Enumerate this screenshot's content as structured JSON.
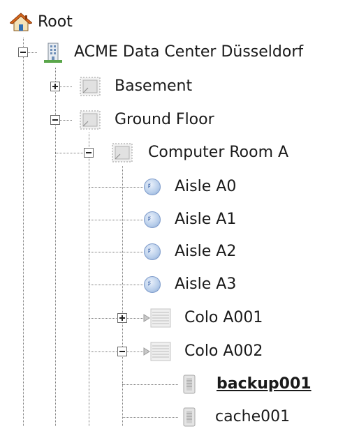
{
  "tree": {
    "root": {
      "label": "Root",
      "icon": "house-icon"
    },
    "site": {
      "label": "ACME Data Center Düsseldorf",
      "icon": "building-icon",
      "state": "expanded"
    },
    "basement": {
      "label": "Basement",
      "icon": "floor-plan-icon",
      "state": "collapsed"
    },
    "ground_floor": {
      "label": "Ground Floor",
      "icon": "floor-plan-icon",
      "state": "expanded"
    },
    "room": {
      "label": "Computer Room A",
      "icon": "floor-plan-icon",
      "state": "expanded"
    },
    "aisles": [
      {
        "label": "Aisle A0",
        "icon": "aisle-icon"
      },
      {
        "label": "Aisle A1",
        "icon": "aisle-icon"
      },
      {
        "label": "Aisle A2",
        "icon": "aisle-icon"
      },
      {
        "label": "Aisle A3",
        "icon": "aisle-icon"
      }
    ],
    "colos": [
      {
        "label": "Colo A001",
        "icon": "rack-icon",
        "state": "collapsed"
      },
      {
        "label": "Colo A002",
        "icon": "rack-icon",
        "state": "expanded"
      }
    ],
    "servers": [
      {
        "label": "backup001",
        "icon": "server-icon",
        "selected": true
      },
      {
        "label": "cache001",
        "icon": "server-icon",
        "selected": false
      }
    ]
  },
  "colors": {
    "line": "#7a7a7a",
    "text": "#1a1a1a",
    "aisle_blue": "#88a7d2",
    "house_roof": "#d9691c",
    "building_green": "#5aa64a"
  }
}
